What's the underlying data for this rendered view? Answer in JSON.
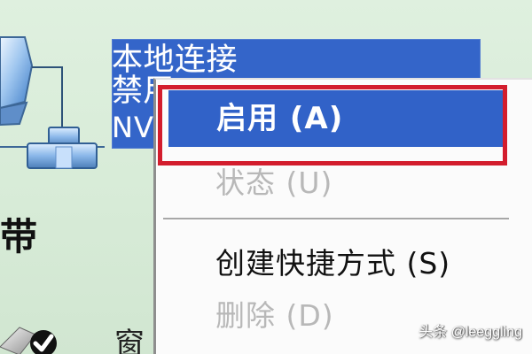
{
  "selection": {
    "line1": "本地连接",
    "line2": "禁用",
    "line3": "NV"
  },
  "context_menu": {
    "items": [
      {
        "label": "启用 (A)"
      },
      {
        "label": "状态 (U)"
      },
      {
        "label": "创建快捷方式 (S)"
      },
      {
        "label": "删除 (D)"
      }
    ]
  },
  "background": {
    "left_char": "带",
    "bottom_partial_char": "窗"
  },
  "watermark": {
    "text": "头条 @leeggling"
  }
}
